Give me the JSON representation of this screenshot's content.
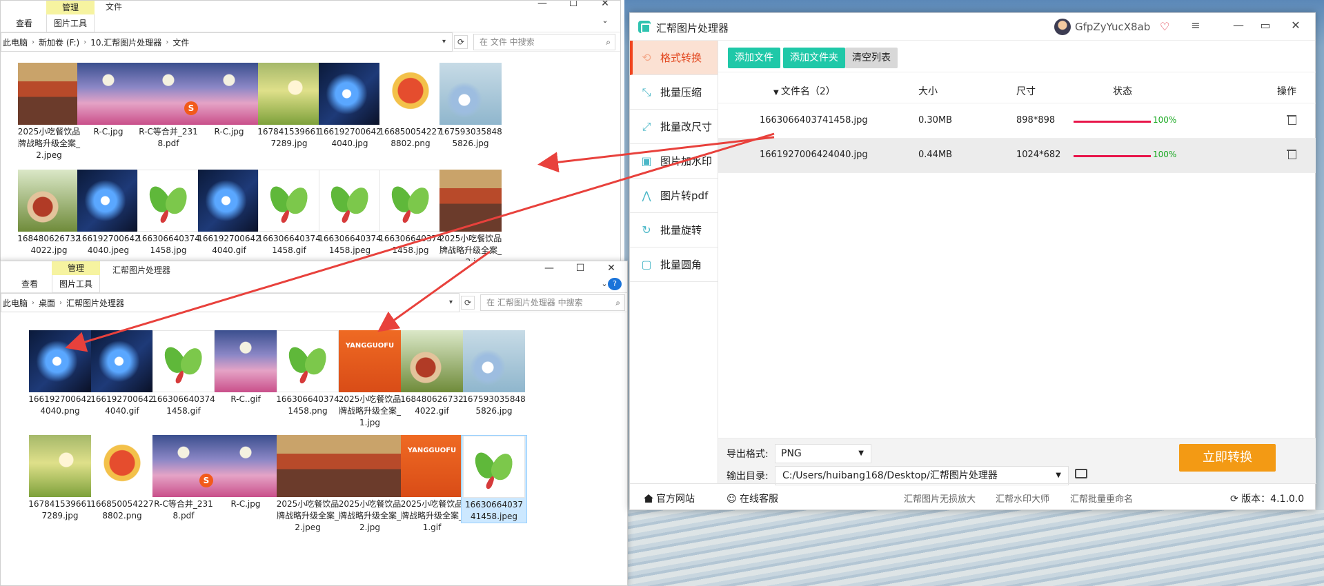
{
  "top_explorer": {
    "ctx_head": "管理",
    "ctx_tab": "图片工具",
    "tab_view": "查看",
    "title": "文件",
    "breadcrumb": [
      "此电脑",
      "新加卷 (F:)",
      "10.汇帮图片处理器",
      "文件"
    ],
    "search_placeholder": "在 文件 中搜索",
    "files": [
      {
        "name": "2025小吃餐饮品牌战略升级全案_2.jpeg",
        "thumb": "city"
      },
      {
        "name": "R-C.jpg",
        "thumb": "moon"
      },
      {
        "name": "R-C等合并_2318.pdf",
        "thumb": "moon"
      },
      {
        "name": "R-C.jpg",
        "thumb": "moon"
      },
      {
        "name": "1678415396617289.jpg",
        "thumb": "girl"
      },
      {
        "name": "1661927006424040.jpg",
        "thumb": "blue"
      },
      {
        "name": "1668500542278802.png",
        "thumb": "tiger"
      },
      {
        "name": "1675930358485826.jpg",
        "thumb": "flower"
      },
      {
        "name": "1684806267324022.jpg",
        "thumb": "food"
      },
      {
        "name": "1661927006424040.jpeg",
        "thumb": "blue"
      },
      {
        "name": "1663066403741458.jpg",
        "thumb": "leaf"
      },
      {
        "name": "1661927006424040.gif",
        "thumb": "blue"
      },
      {
        "name": "1663066403741458.gif",
        "thumb": "leaf"
      },
      {
        "name": "1663066403741458.jpeg",
        "thumb": "leaf"
      },
      {
        "name": "1663066403741458.jpg",
        "thumb": "leaf"
      },
      {
        "name": "2025小吃餐饮品牌战略升级全案_2.j",
        "thumb": "city"
      }
    ]
  },
  "bottom_explorer": {
    "ctx_head": "管理",
    "ctx_tab": "图片工具",
    "tab_view": "查看",
    "title": "汇帮图片处理器",
    "breadcrumb": [
      "此电脑",
      "桌面",
      "汇帮图片处理器"
    ],
    "search_placeholder": "在 汇帮图片处理器 中搜索",
    "files": [
      {
        "name": "1661927006424040.png",
        "thumb": "blue"
      },
      {
        "name": "1661927006424040.gif",
        "thumb": "blue"
      },
      {
        "name": "1663066403741458.gif",
        "thumb": "leaf"
      },
      {
        "name": "R-C..gif",
        "thumb": "moon"
      },
      {
        "name": "1663066403741458.png",
        "thumb": "leaf"
      },
      {
        "name": "2025小吃餐饮品牌战略升级全案_1.jpg",
        "thumb": "yang"
      },
      {
        "name": "1684806267324022.gif",
        "thumb": "food"
      },
      {
        "name": "1675930358485826.jpg",
        "thumb": "flower"
      },
      {
        "name": "1678415396617289.jpg",
        "thumb": "girl"
      },
      {
        "name": "1668500542278802.png",
        "thumb": "tiger"
      },
      {
        "name": "R-C等合并_2318.pdf",
        "thumb": "moon"
      },
      {
        "name": "R-C.jpg",
        "thumb": "moon"
      },
      {
        "name": "2025小吃餐饮品牌战略升级全案_2.jpeg",
        "thumb": "city"
      },
      {
        "name": "2025小吃餐饮品牌战略升级全案_2.jpg",
        "thumb": "city"
      },
      {
        "name": "2025小吃餐饮品牌战略升级全案_1.gif",
        "thumb": "yang"
      },
      {
        "name": "1663066403741458.jpeg",
        "thumb": "leaf"
      }
    ]
  },
  "app": {
    "title": "汇帮图片处理器",
    "username": "GfpZyYucX8ab",
    "sidebar": [
      {
        "label": "格式转换",
        "icon": "refresh-icon"
      },
      {
        "label": "批量压缩",
        "icon": "compress-icon"
      },
      {
        "label": "批量改尺寸",
        "icon": "resize-icon"
      },
      {
        "label": "图片加水印",
        "icon": "watermark-icon"
      },
      {
        "label": "图片转pdf",
        "icon": "pdf-icon"
      },
      {
        "label": "批量旋转",
        "icon": "rotate-icon"
      },
      {
        "label": "批量圆角",
        "icon": "round-corner-icon"
      }
    ],
    "toolbar": {
      "add_file": "添加文件",
      "add_folder": "添加文件夹",
      "clear_list": "清空列表"
    },
    "table_headers": {
      "name": "文件名（2）",
      "size": "大小",
      "dimensions": "尺寸",
      "status": "状态",
      "action": "操作"
    },
    "rows": [
      {
        "name": "1663066403741458.jpg",
        "size": "0.30MB",
        "dimensions": "898*898",
        "progress_pct": 100,
        "progress_label": "100%"
      },
      {
        "name": "1661927006424040.jpg",
        "size": "0.44MB",
        "dimensions": "1024*682",
        "progress_pct": 100,
        "progress_label": "100%"
      }
    ],
    "export_format_label": "导出格式:",
    "export_format": "PNG",
    "output_dir_label": "输出目录:",
    "output_dir": "C:/Users/huibang168/Desktop/汇帮图片处理器",
    "convert_button": "立即转换",
    "footer": {
      "website": "官方网站",
      "support": "在线客服",
      "link1": "汇帮图片无损放大",
      "link2": "汇帮水印大师",
      "link3": "汇帮批量重命名",
      "version": "版本：4.1.0.0"
    },
    "colors": {
      "accent_teal": "#1fc8a8",
      "active_orange": "#f0441e",
      "convert_orange": "#f39a14",
      "progress_red": "#e8154a",
      "pct_green": "#17a81f"
    }
  }
}
